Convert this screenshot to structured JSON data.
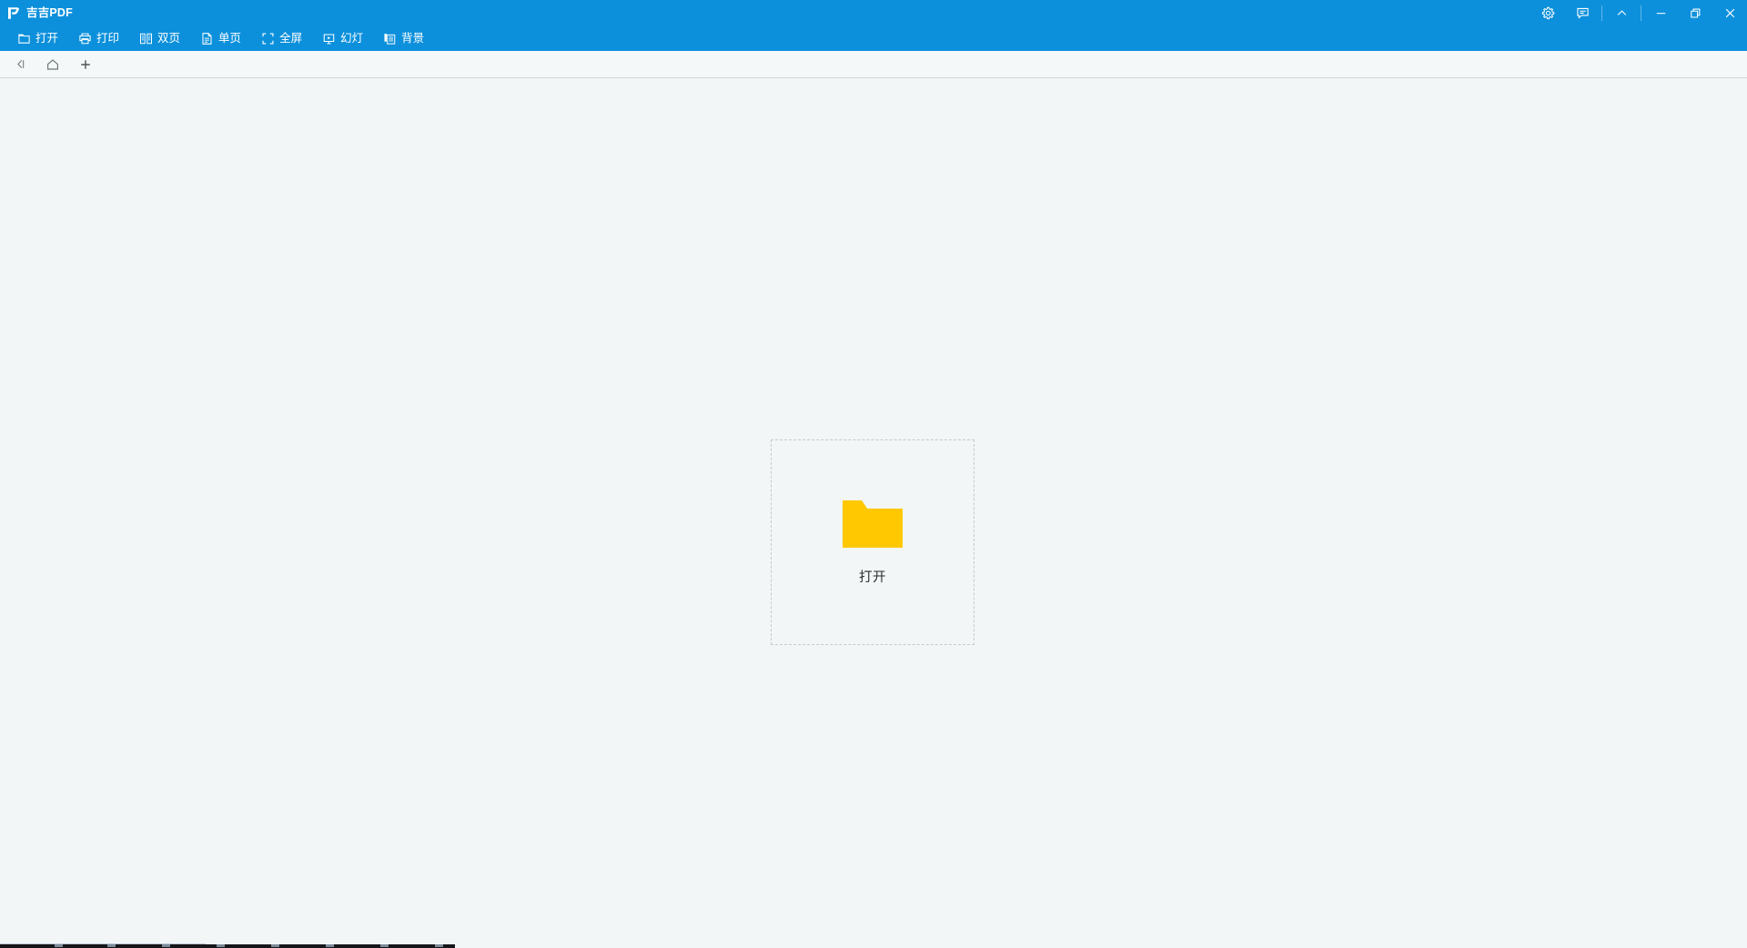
{
  "app": {
    "title": "吉吉PDF",
    "logo_icon": "jiji-p-logo-icon",
    "accent_color": "#0c90dc",
    "content_background": "#f2f6f7",
    "folder_color": "#ffc800",
    "folder_tab_color": "#e8a300"
  },
  "titlebar": {
    "controls": [
      {
        "name": "settings-gear-icon",
        "label": "设置",
        "icon": "gear-icon"
      },
      {
        "name": "feedback-message-icon",
        "label": "反馈",
        "icon": "message-icon"
      },
      {
        "name": "collapse-chevron-up-icon",
        "label": "收起",
        "icon": "chevron-up-icon"
      },
      {
        "name": "minimize-button",
        "label": "最小化",
        "icon": "minimize-icon"
      },
      {
        "name": "maximize-button",
        "label": "最大化",
        "icon": "restore-icon"
      },
      {
        "name": "close-button",
        "label": "关闭",
        "icon": "close-icon"
      }
    ]
  },
  "toolbar": {
    "items": [
      {
        "label": "打开",
        "icon": "folder-open-icon"
      },
      {
        "label": "打印",
        "icon": "printer-icon"
      },
      {
        "label": "双页",
        "icon": "dual-page-icon"
      },
      {
        "label": "单页",
        "icon": "single-page-icon"
      },
      {
        "label": "全屏",
        "icon": "fullscreen-icon"
      },
      {
        "label": "幻灯",
        "icon": "slideshow-icon"
      },
      {
        "label": "背景",
        "icon": "background-icon"
      }
    ]
  },
  "tabstrip": {
    "buttons": [
      {
        "label": "返回",
        "icon": "collapse-left-icon"
      },
      {
        "label": "主页",
        "icon": "home-icon"
      },
      {
        "label": "新建标签页",
        "icon": "plus-icon"
      }
    ]
  },
  "main": {
    "dropzone": {
      "label": "打开",
      "icon": "folder-icon"
    }
  }
}
